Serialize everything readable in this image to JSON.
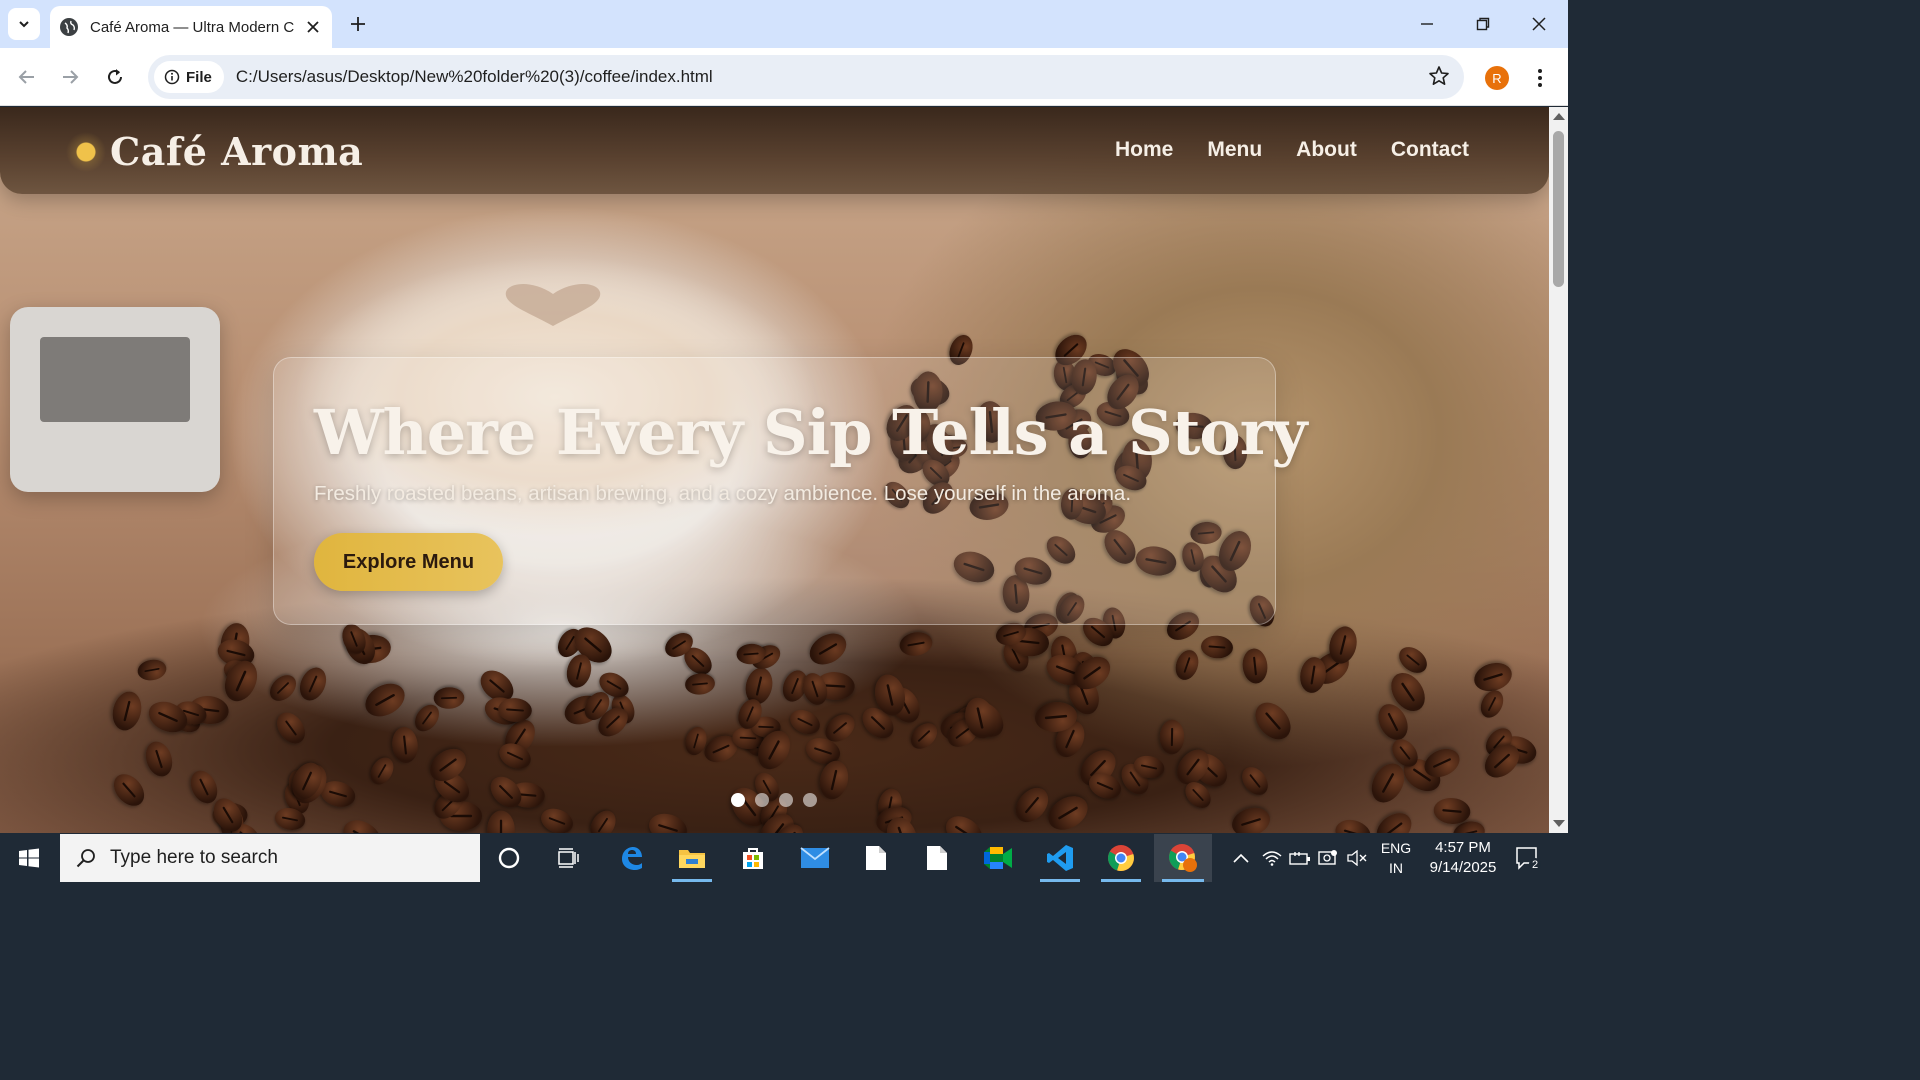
{
  "browser": {
    "tab_title": "Café Aroma — Ultra Modern Co",
    "address_chip": "File",
    "url": "C:/Users/asus/Desktop/New%20folder%20(3)/coffee/index.html",
    "profile_initial": "R"
  },
  "site": {
    "brand": "Café Aroma",
    "nav": [
      "Home",
      "Menu",
      "About",
      "Contact"
    ],
    "hero": {
      "title": "Where Every Sip Tells a Story",
      "subtitle": "Freshly roasted beans, artisan brewing, and a cozy ambience. Lose yourself in the aroma.",
      "cta_label": "Explore Menu"
    },
    "slider_dots": 4,
    "active_slide": 1,
    "accent_color": "#e0b53e"
  },
  "taskbar": {
    "search_placeholder": "Type here to search",
    "language_line1": "ENG",
    "language_line2": "IN",
    "time": "4:57 PM",
    "date": "9/14/2025",
    "notification_count": "2",
    "pinned_apps": [
      "cortana",
      "task-view",
      "edge",
      "file-explorer",
      "microsoft-store",
      "mail",
      "file",
      "file",
      "meet",
      "vscode",
      "chrome",
      "chrome-profile"
    ]
  }
}
